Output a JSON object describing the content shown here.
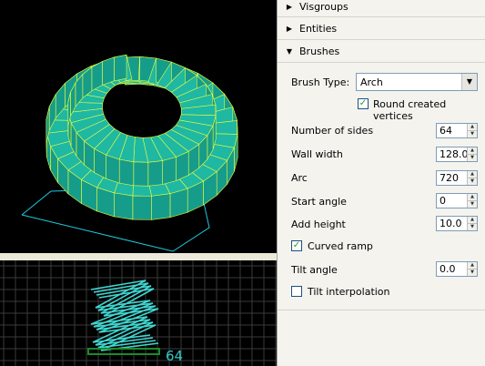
{
  "panel": {
    "sections": {
      "visgroups": {
        "label": "Visgroups",
        "expanded": false
      },
      "entities": {
        "label": "Entities",
        "expanded": false
      },
      "brushes": {
        "label": "Brushes",
        "expanded": true
      }
    },
    "brush_type": {
      "label": "Brush Type:",
      "value": "Arch"
    },
    "round_vertices": {
      "label": "Round created vertices",
      "checked": true
    },
    "fields": {
      "num_sides": {
        "label": "Number of sides",
        "value": "64"
      },
      "wall_width": {
        "label": "Wall width",
        "value": "128.0"
      },
      "arc": {
        "label": "Arc",
        "value": "720"
      },
      "start_angle": {
        "label": "Start angle",
        "value": "0"
      },
      "add_height": {
        "label": "Add height",
        "value": "10.0"
      },
      "tilt_angle": {
        "label": "Tilt angle",
        "value": "0.0"
      }
    },
    "curved_ramp": {
      "label": "Curved ramp",
      "checked": true
    },
    "tilt_interp": {
      "label": "Tilt interpolation",
      "checked": false
    }
  },
  "viewport2d": {
    "sides_readout": "64"
  },
  "icons": {
    "collapsed": "triangle-right-icon",
    "expanded": "triangle-down-icon",
    "dropdown": "chevron-down-icon",
    "check": "checkmark-icon"
  },
  "colors": {
    "mesh_fill": "#1fb8a3",
    "mesh_edge": "#e8ff3c",
    "wire_2d": "#3fd6d0",
    "readout": "#32c8c8",
    "grid": "#3a3a3a",
    "bounds": "#1ec8e0"
  }
}
